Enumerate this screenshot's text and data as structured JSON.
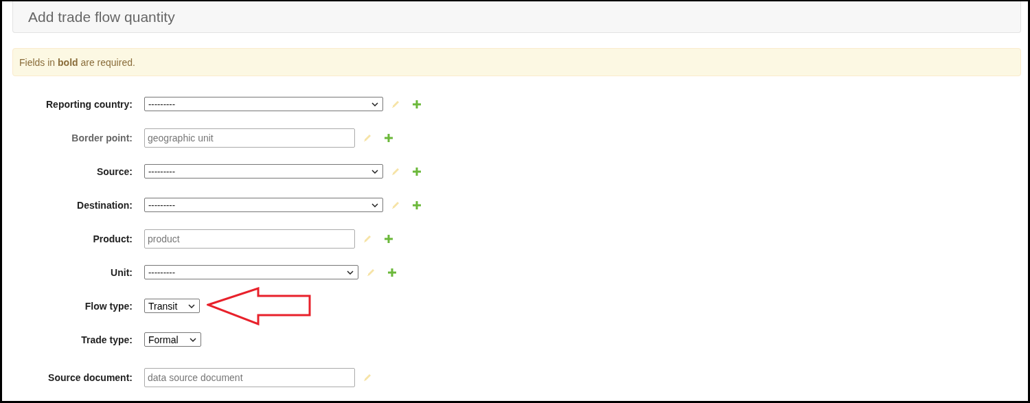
{
  "panel": {
    "title": "Add trade flow quantity"
  },
  "notice": "Fields in **bold** are required.",
  "fields": [
    {
      "label": "Reporting country:",
      "kind": "wide-select",
      "value": "---------",
      "dimmed": false,
      "editable": true,
      "addable": true,
      "pointer": false
    },
    {
      "label": "Border point:",
      "kind": "text",
      "placeholder": "geographic unit",
      "dimmed": true,
      "editable": true,
      "addable": true,
      "pointer": false
    },
    {
      "label": "Source:",
      "kind": "wide-select",
      "value": "---------",
      "dimmed": false,
      "editable": true,
      "addable": true,
      "pointer": false
    },
    {
      "label": "Destination:",
      "kind": "wide-select",
      "value": "---------",
      "dimmed": false,
      "editable": true,
      "addable": true,
      "pointer": false
    },
    {
      "label": "Product:",
      "kind": "text",
      "placeholder": "product",
      "dimmed": false,
      "editable": true,
      "addable": true,
      "pointer": false
    },
    {
      "label": "Unit:",
      "kind": "select",
      "value": "---------",
      "dimmed": false,
      "editable": true,
      "addable": true,
      "pointer": false
    },
    {
      "label": "Flow type:",
      "kind": "small-select",
      "value": "Transit",
      "dimmed": false,
      "editable": false,
      "addable": false,
      "pointer": true
    },
    {
      "label": "Trade type:",
      "kind": "small-select",
      "value": "Formal",
      "dimmed": false,
      "editable": false,
      "addable": false,
      "pointer": false
    },
    {
      "label": "Source document:",
      "kind": "text",
      "placeholder": "data source document",
      "dimmed": false,
      "editable": true,
      "addable": false,
      "pointer": false
    }
  ]
}
